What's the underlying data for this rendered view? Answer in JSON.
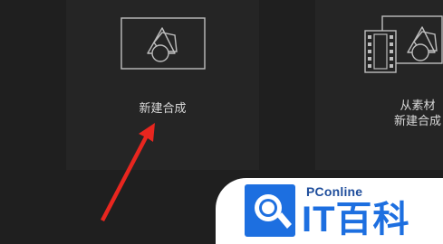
{
  "cards": {
    "new_composition": {
      "label": "新建合成",
      "icon": "composition-icon"
    },
    "from_footage": {
      "label_line1": "从素材",
      "label_line2": "新建合成",
      "icon": "footage-composition-icon"
    }
  },
  "annotation": {
    "arrow_color": "#e8261f",
    "icon": "arrow-annotation-icon"
  },
  "watermark": {
    "brand": "PConline",
    "title": "IT百科",
    "logo_icon": "search-magnifier-logo-icon",
    "brand_color": "#1f4e9c",
    "accent_color": "#1d6fe0"
  }
}
